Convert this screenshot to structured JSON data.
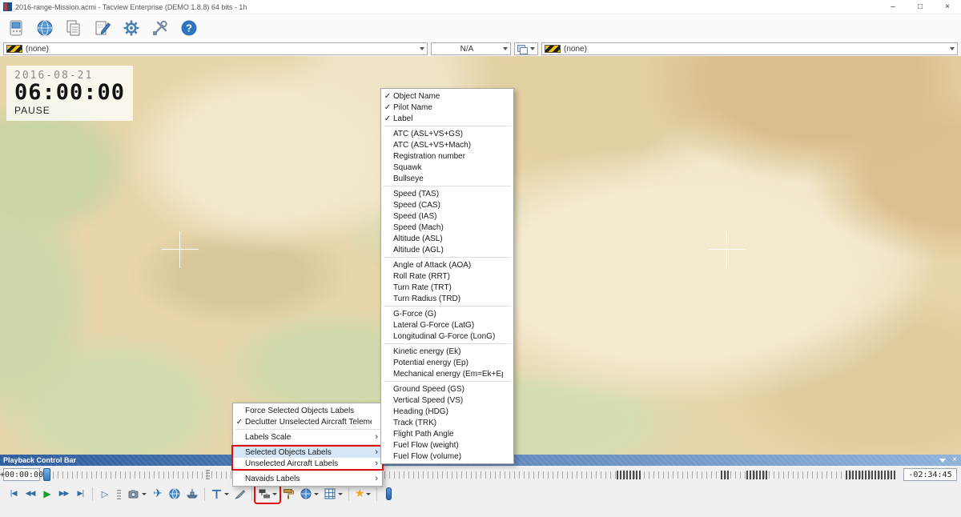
{
  "window": {
    "title": "2016-range-Mission.acmi - Tacview Enterprise (DEMO 1.8.8) 64 bits - 1h"
  },
  "icons": {
    "check": "✓",
    "submenu_arrow": "›",
    "minimize": "–",
    "maximize": "□",
    "close": "×",
    "help": "?",
    "skip_start": "|◀",
    "rewind": "◀◀",
    "play": "▶",
    "fast_forward": "▶▶",
    "skip_end": "▶|",
    "step": "▷",
    "star": "★",
    "aircraft": "✈"
  },
  "selectors": {
    "left": {
      "value": "(none)"
    },
    "middle": {
      "value": "N/A"
    },
    "right": {
      "value": "(none)"
    }
  },
  "clock": {
    "date": "2016-08-21",
    "time": "06:00:00",
    "state": "PAUSE"
  },
  "labels_menu": {
    "items": [
      {
        "label": "Force Selected Objects Labels"
      },
      {
        "label": "Declutter Unselected Aircraft Telemetry",
        "checked": true
      },
      "---",
      {
        "label": "Labels Scale",
        "submenu": true
      },
      "---",
      {
        "label": "Selected Objects Labels",
        "submenu": true,
        "highlighted": true
      },
      {
        "label": "Unselected Aircraft Labels",
        "submenu": true
      },
      "---",
      {
        "label": "Navaids Labels",
        "submenu": true
      }
    ]
  },
  "fields_menu": {
    "items": [
      {
        "label": "Object Name",
        "checked": true
      },
      {
        "label": "Pilot Name",
        "checked": true
      },
      {
        "label": "Label",
        "checked": true
      },
      "---",
      {
        "label": "ATC (ASL+VS+GS)"
      },
      {
        "label": "ATC (ASL+VS+Mach)"
      },
      {
        "label": "Registration number"
      },
      {
        "label": "Squawk"
      },
      {
        "label": "Bullseye"
      },
      "---",
      {
        "label": "Speed (TAS)"
      },
      {
        "label": "Speed (CAS)"
      },
      {
        "label": "Speed (IAS)"
      },
      {
        "label": "Speed (Mach)"
      },
      {
        "label": "Altitude (ASL)"
      },
      {
        "label": "Altitude (AGL)"
      },
      "---",
      {
        "label": "Angle of Attack (AOA)"
      },
      {
        "label": "Roll Rate (RRT)"
      },
      {
        "label": "Turn Rate (TRT)"
      },
      {
        "label": "Turn Radius (TRD)"
      },
      "---",
      {
        "label": "G-Force (G)"
      },
      {
        "label": "Lateral G-Force (LatG)"
      },
      {
        "label": "Longitudinal G-Force (LonG)"
      },
      "---",
      {
        "label": "Kinetic energy (Ek)"
      },
      {
        "label": "Potential energy (Ep)"
      },
      {
        "label": "Mechanical energy (Em=Ek+Ep)"
      },
      "---",
      {
        "label": "Ground Speed (GS)"
      },
      {
        "label": "Vertical Speed (VS)"
      },
      {
        "label": "Heading (HDG)"
      },
      {
        "label": "Track (TRK)"
      },
      {
        "label": "Flight Path Angle"
      },
      {
        "label": "Fuel Flow (weight)"
      },
      {
        "label": "Fuel Flow (volume)"
      }
    ]
  },
  "playback": {
    "title": "Playback Control Bar",
    "elapsed": "+00:00:00",
    "remaining": "-02:34:45"
  },
  "annotations": {
    "menu_red_box_rows": [
      3,
      4
    ],
    "highlighted_button": "labels-button",
    "color": "#e01010"
  },
  "colors": {
    "accent": "#2f74c0",
    "map_base": "#e8d5a9",
    "playback_strip_start": "#2d5c9e",
    "playback_strip_end": "#8fb2da"
  }
}
